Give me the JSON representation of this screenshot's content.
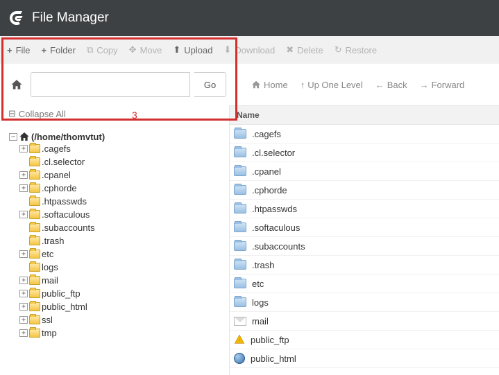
{
  "header": {
    "title": "File Manager"
  },
  "toolbar": {
    "file": "File",
    "folder": "Folder",
    "copy": "Copy",
    "move": "Move",
    "upload": "Upload",
    "download": "Download",
    "delete": "Delete",
    "restore": "Restore"
  },
  "pathbar": {
    "go": "Go",
    "home": "Home",
    "up": "Up One Level",
    "back": "Back",
    "forward": "Forward",
    "path": ""
  },
  "sidebar": {
    "collapse": "Collapse All",
    "root": "(/home/thomvtut)",
    "items": [
      {
        "label": ".cagefs",
        "exp": true
      },
      {
        "label": ".cl.selector",
        "exp": false
      },
      {
        "label": ".cpanel",
        "exp": true
      },
      {
        "label": ".cphorde",
        "exp": true
      },
      {
        "label": ".htpasswds",
        "exp": false
      },
      {
        "label": ".softaculous",
        "exp": true
      },
      {
        "label": ".subaccounts",
        "exp": false
      },
      {
        "label": ".trash",
        "exp": false
      },
      {
        "label": "etc",
        "exp": true
      },
      {
        "label": "logs",
        "exp": false
      },
      {
        "label": "mail",
        "exp": true
      },
      {
        "label": "public_ftp",
        "exp": true
      },
      {
        "label": "public_html",
        "exp": true
      },
      {
        "label": "ssl",
        "exp": true
      },
      {
        "label": "tmp",
        "exp": true
      }
    ]
  },
  "content": {
    "nameHeader": "Name",
    "rows": [
      {
        "label": ".cagefs",
        "icon": "folder"
      },
      {
        "label": ".cl.selector",
        "icon": "folder"
      },
      {
        "label": ".cpanel",
        "icon": "folder"
      },
      {
        "label": ".cphorde",
        "icon": "folder"
      },
      {
        "label": ".htpasswds",
        "icon": "folder"
      },
      {
        "label": ".softaculous",
        "icon": "folder"
      },
      {
        "label": ".subaccounts",
        "icon": "folder"
      },
      {
        "label": ".trash",
        "icon": "folder"
      },
      {
        "label": "etc",
        "icon": "folder"
      },
      {
        "label": "logs",
        "icon": "folder"
      },
      {
        "label": "mail",
        "icon": "mail"
      },
      {
        "label": "public_ftp",
        "icon": "warn"
      },
      {
        "label": "public_html",
        "icon": "globe"
      }
    ]
  },
  "annotation": {
    "num": "3"
  }
}
